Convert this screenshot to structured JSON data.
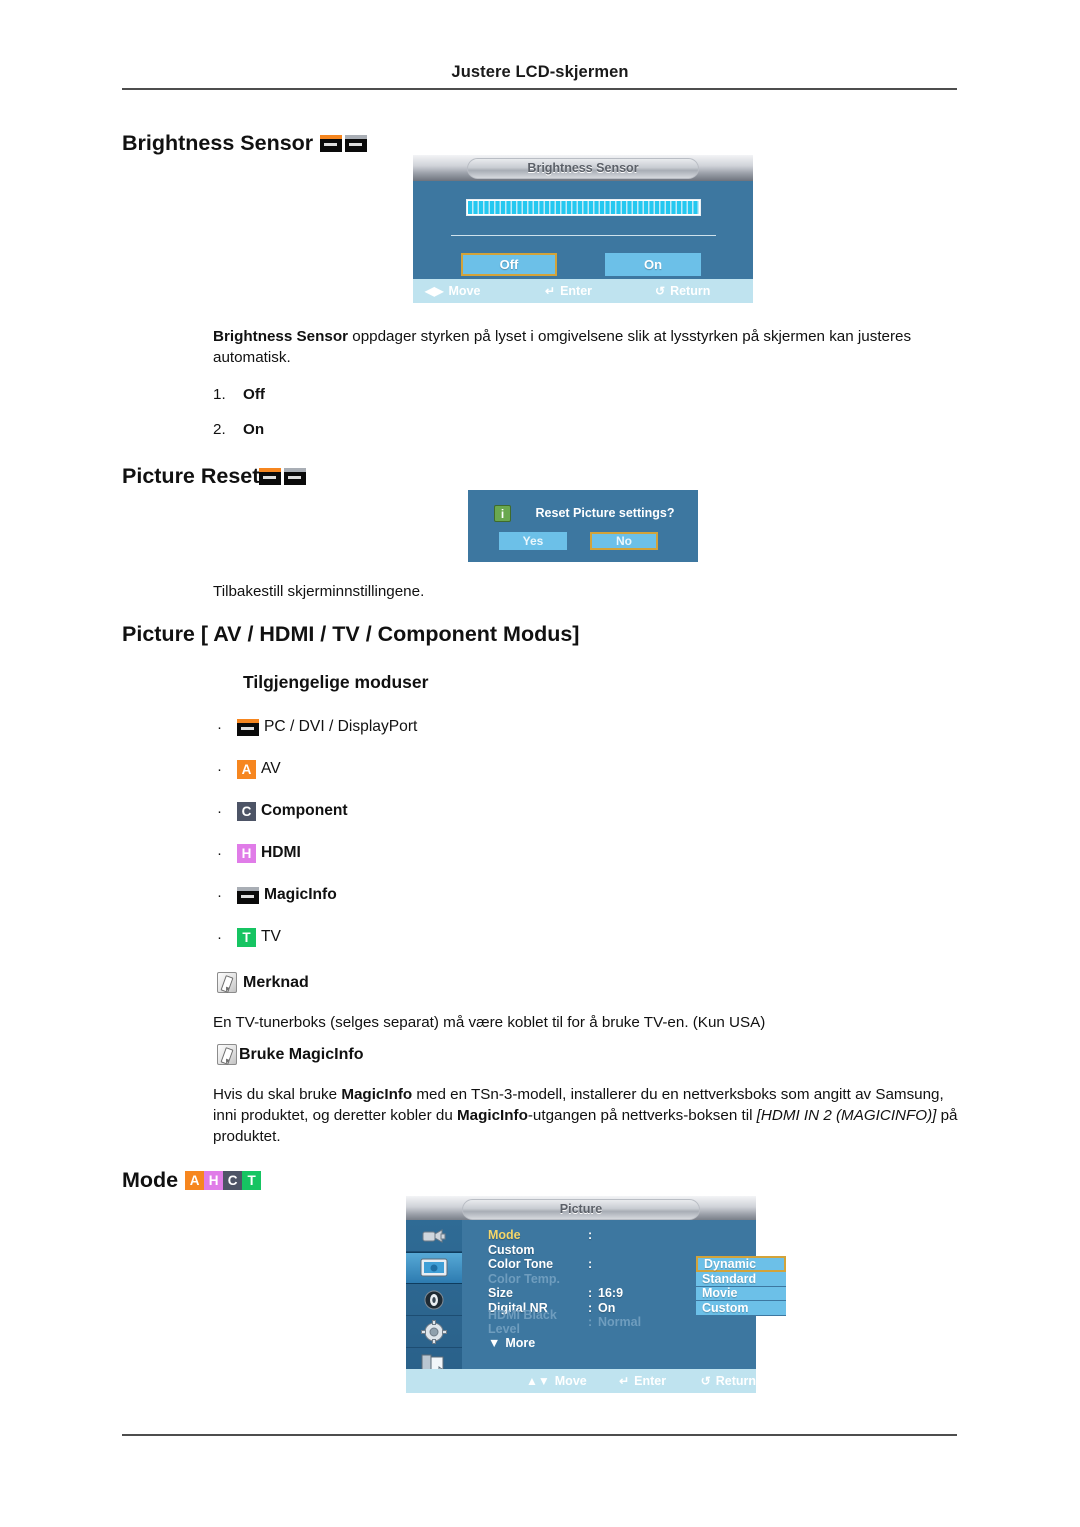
{
  "page": {
    "running_head": "Justere LCD-skjermen"
  },
  "sections": {
    "brightness_sensor": {
      "heading": "Brightness Sensor",
      "badges": [
        "pc-monitor-icon",
        "magicinfo-monitor-icon"
      ],
      "paragraph_lead": "Brightness Sensor",
      "paragraph_rest": " oppdager styrken på lyset i omgivelsene slik at lysstyrken på skjermen kan justeres automatisk.",
      "list": [
        {
          "num": "1.",
          "text": "Off"
        },
        {
          "num": "2.",
          "text": "On"
        }
      ]
    },
    "picture_reset": {
      "heading": "Picture Reset",
      "badges": [
        "pc-monitor-icon",
        "magicinfo-monitor-icon"
      ],
      "description": "Tilbakestill skjerminnstillingene."
    },
    "picture_modes": {
      "heading": "Picture [ AV / HDMI / TV / Component Modus]",
      "subheading": "Tilgjengelige moduser",
      "bullets": [
        {
          "badge": "pc-monitor-icon",
          "badge_type": "monitor-pc",
          "label": "PC / DVI / DisplayPort",
          "bold": false
        },
        {
          "badge": "A",
          "badge_type": "av",
          "label": "AV",
          "bold": false
        },
        {
          "badge": "C",
          "badge_type": "component",
          "label": "Component",
          "bold": true
        },
        {
          "badge": "H",
          "badge_type": "hdmi",
          "label": "HDMI",
          "bold": true
        },
        {
          "badge": "magicinfo-monitor-icon",
          "badge_type": "monitor-magicinfo",
          "label": "MagicInfo",
          "bold": true
        },
        {
          "badge": "T",
          "badge_type": "tv",
          "label": "TV",
          "bold": false
        }
      ],
      "note_label": "Merknad",
      "note_text": "En TV-tunerboks (selges separat) må være koblet til for å bruke TV-en. (Kun USA)",
      "note2_label": "Bruke MagicInfo",
      "magicinfo_paragraph": {
        "p1": "Hvis du skal bruke ",
        "b1": "MagicInfo",
        "p2": " med en TSn-3-modell, installerer du en nettverksboks som angitt av Samsung, inni produktet, og deretter kobler du ",
        "b2": "MagicInfo",
        "p3": "-utgangen på nettverks-boksen til ",
        "i1": "[HDMI IN 2 (MAGICINFO)]",
        "p4": " på produktet."
      }
    },
    "mode": {
      "heading": "Mode",
      "badges": [
        {
          "letter": "A",
          "type": "av",
          "color": "#f6861f"
        },
        {
          "letter": "H",
          "type": "hdmi",
          "color": "#e07ce8"
        },
        {
          "letter": "C",
          "type": "component",
          "color": "#4d5466"
        },
        {
          "letter": "T",
          "type": "tv",
          "color": "#16c462"
        }
      ]
    }
  },
  "osd_brightness": {
    "title": "Brightness Sensor",
    "bar_value": 100,
    "buttons": [
      {
        "label": "Off",
        "focused": true
      },
      {
        "label": "On",
        "focused": false
      }
    ],
    "footer": [
      {
        "icon": "left-right-arrow-icon",
        "glyph": "◀▶",
        "label": "Move"
      },
      {
        "icon": "enter-icon",
        "glyph": "↵",
        "label": "Enter"
      },
      {
        "icon": "return-icon",
        "glyph": "↺",
        "label": "Return"
      }
    ]
  },
  "osd_reset": {
    "icon": "info-icon",
    "question": "Reset Picture settings?",
    "buttons": [
      {
        "label": "Yes",
        "focused": false
      },
      {
        "label": "No",
        "focused": true
      }
    ]
  },
  "osd_picture": {
    "title": "Picture",
    "sidebar": [
      {
        "name": "input-icon",
        "selected": false
      },
      {
        "name": "picture-icon",
        "selected": true
      },
      {
        "name": "sound-icon",
        "selected": false
      },
      {
        "name": "setup-icon",
        "selected": false
      },
      {
        "name": "multi-control-icon",
        "selected": false
      }
    ],
    "items": [
      {
        "key": "Mode",
        "sep": ":",
        "value": "",
        "state": "active"
      },
      {
        "key": "Custom",
        "sep": "",
        "value": "",
        "state": "normal"
      },
      {
        "key": "Color Tone",
        "sep": ":",
        "value": "",
        "state": "normal"
      },
      {
        "key": "Color Temp.",
        "sep": "",
        "value": "",
        "state": "dim"
      },
      {
        "key": "Size",
        "sep": ":",
        "value": "16:9",
        "state": "normal"
      },
      {
        "key": "Digital NR",
        "sep": ":",
        "value": "On",
        "state": "normal"
      },
      {
        "key": "HDMI Black Level",
        "sep": ":",
        "value": "Normal",
        "state": "dim"
      }
    ],
    "more_label": "More",
    "more_icon": "caret-down-icon",
    "popup_options": [
      {
        "label": "Dynamic",
        "selected": true
      },
      {
        "label": "Standard",
        "selected": false
      },
      {
        "label": "Movie",
        "selected": false
      },
      {
        "label": "Custom",
        "selected": false
      }
    ],
    "footer": [
      {
        "icon": "up-down-arrow-icon",
        "glyph": "▲▼",
        "label": "Move"
      },
      {
        "icon": "enter-icon",
        "glyph": "↵",
        "label": "Enter"
      },
      {
        "icon": "return-icon",
        "glyph": "↺",
        "label": "Return"
      }
    ]
  }
}
